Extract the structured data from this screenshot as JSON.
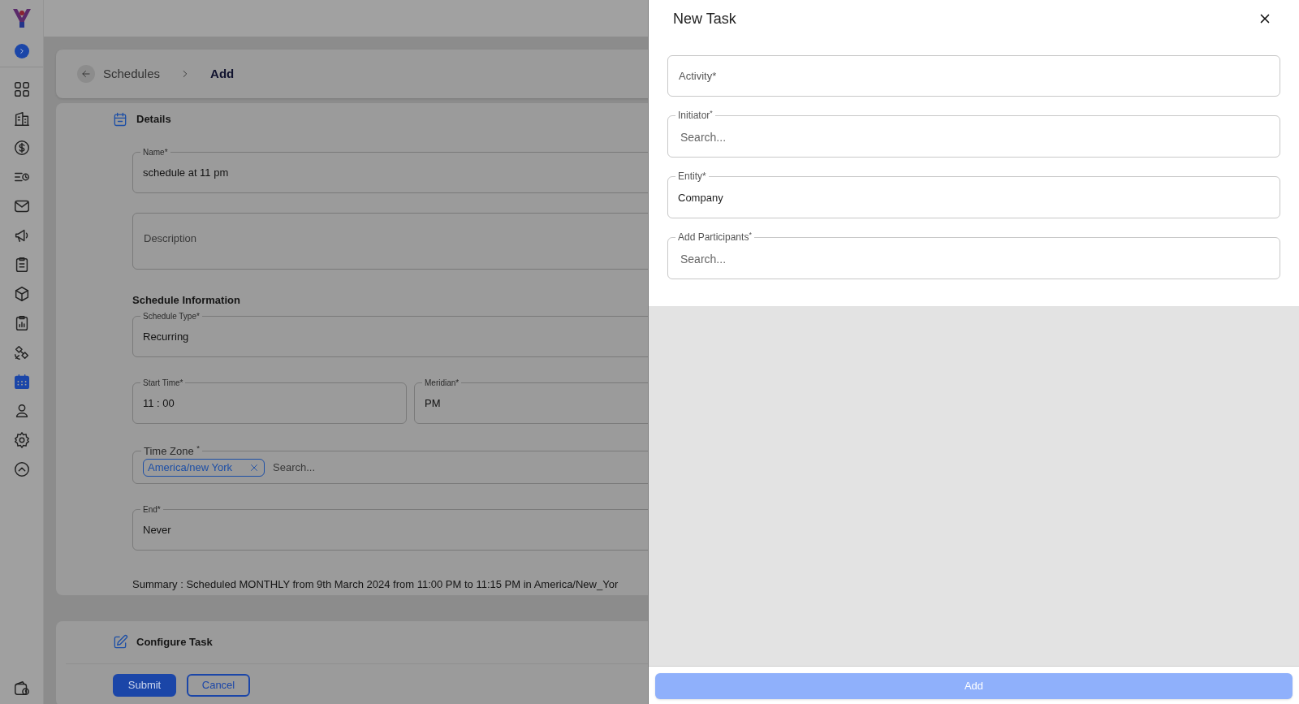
{
  "sidebar": {
    "items": [
      {
        "selected": false
      },
      {
        "selected": false
      },
      {
        "selected": false
      },
      {
        "selected": false
      },
      {
        "selected": false
      },
      {
        "selected": false
      },
      {
        "selected": false
      },
      {
        "selected": false
      },
      {
        "selected": false
      },
      {
        "selected": false
      },
      {
        "selected": true
      },
      {
        "selected": false
      },
      {
        "selected": false
      },
      {
        "selected": false
      }
    ]
  },
  "breadcrumb": {
    "items": [
      "Schedules",
      "Add"
    ]
  },
  "details": {
    "title": "Details",
    "fields": [
      {
        "kind": "text",
        "label": "Name*",
        "value": "schedule at 11 pm"
      },
      {
        "kind": "textarea",
        "placeholder": "Description"
      },
      {
        "kind": "heading",
        "text": "Schedule Information"
      },
      {
        "kind": "text",
        "label": "Schedule Type*",
        "value": "Recurring"
      },
      {
        "kind": "row",
        "fields": [
          {
            "kind": "text",
            "label": "Start Time*",
            "value": "11 : 00"
          },
          {
            "kind": "text",
            "label": "Meridian*",
            "value": "PM"
          }
        ]
      },
      {
        "kind": "chips",
        "label": "Time Zone $^{*}$",
        "chips": [
          "America/new York"
        ],
        "placeholder": "Search..."
      },
      {
        "kind": "text",
        "label": "End*",
        "value": "Never"
      },
      {
        "kind": "summary",
        "text": "Summary : Scheduled MONTHLY from 9th March 2024 from 11:00 PM to 11:15 PM in America/New_Yor"
      }
    ]
  },
  "configure_task": {
    "title": "Configure Task",
    "buttons": [
      {
        "label": "Submit",
        "kind": "primary"
      },
      {
        "label": "Cancel",
        "kind": "secondary"
      }
    ]
  },
  "drawer": {
    "title": "New Task",
    "fields": [
      {
        "kind": "plain",
        "placeholder": "Activity*"
      },
      {
        "kind": "outlined",
        "label": "Initiator$^{*}$",
        "placeholder": "Search..."
      },
      {
        "kind": "outlined",
        "label": "Entity*",
        "value": "Company"
      },
      {
        "kind": "outlined",
        "label": "Add Participants$^{*}$",
        "placeholder": "Search..."
      }
    ],
    "submit": {
      "label": "Add",
      "disabled": true
    }
  }
}
